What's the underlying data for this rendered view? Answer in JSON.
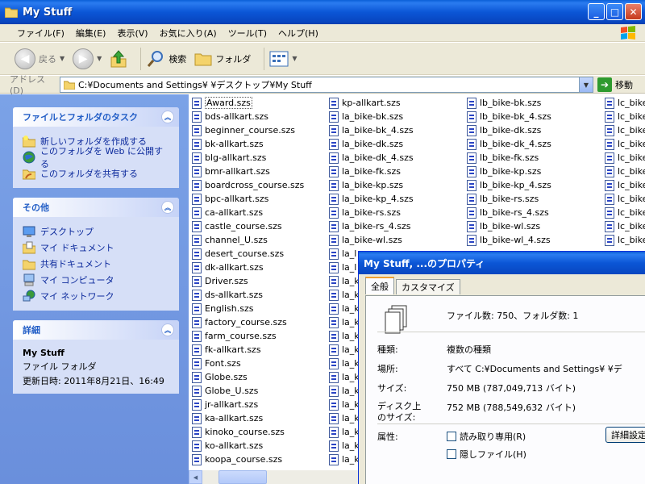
{
  "window": {
    "title": "My Stuff"
  },
  "menu": [
    "ファイル(F)",
    "編集(E)",
    "表示(V)",
    "お気に入り(A)",
    "ツール(T)",
    "ヘルプ(H)"
  ],
  "toolbar": {
    "back": "戻る",
    "search": "検索",
    "folders": "フォルダ"
  },
  "address": {
    "label": "アドレス(D)",
    "path": "C:¥Documents and Settings¥              ¥デスクトップ¥My Stuff",
    "go": "移動"
  },
  "tasks": {
    "title": "ファイルとフォルダのタスク",
    "items": [
      "新しいフォルダを作成する",
      "このフォルダを Web に公開する",
      "このフォルダを共有する"
    ]
  },
  "other": {
    "title": "その他",
    "items": [
      "デスクトップ",
      "マイ ドキュメント",
      "共有ドキュメント",
      "マイ コンピュータ",
      "マイ ネットワーク"
    ]
  },
  "details": {
    "title": "詳細",
    "name": "My Stuff",
    "type": "ファイル フォルダ",
    "modified": "更新日時: 2011年8月21日、16:49"
  },
  "files": {
    "col1": [
      "Award.szs",
      "bds-allkart.szs",
      "beginner_course.szs",
      "bk-allkart.szs",
      "blg-allkart.szs",
      "bmr-allkart.szs",
      "boardcross_course.szs",
      "bpc-allkart.szs",
      "ca-allkart.szs",
      "castle_course.szs",
      "channel_U.szs",
      "desert_course.szs",
      "dk-allkart.szs",
      "Driver.szs",
      "ds-allkart.szs",
      "English.szs",
      "factory_course.szs",
      "farm_course.szs",
      "fk-allkart.szs",
      "Font.szs",
      "Globe.szs",
      "Globe_U.szs",
      "jr-allkart.szs",
      "ka-allkart.szs",
      "kinoko_course.szs",
      "ko-allkart.szs",
      "koopa_course.szs"
    ],
    "col2": [
      "kp-allkart.szs",
      "la_bike-bk.szs",
      "la_bike-bk_4.szs",
      "la_bike-dk.szs",
      "la_bike-dk_4.szs",
      "la_bike-fk.szs",
      "la_bike-kp.szs",
      "la_bike-kp_4.szs",
      "la_bike-rs.szs",
      "la_bike-rs_4.szs",
      "la_bike-wl.szs",
      "la_l",
      "la_l",
      "la_k",
      "la_k",
      "la_k",
      "la_k",
      "la_k",
      "la_k",
      "la_k",
      "la_k",
      "la_k",
      "la_k",
      "la_k",
      "la_k",
      "la_k",
      "la_k"
    ],
    "col3": [
      "lb_bike-bk.szs",
      "lb_bike-bk_4.szs",
      "lb_bike-dk.szs",
      "lb_bike-dk_4.szs",
      "lb_bike-fk.szs",
      "lb_bike-kp.szs",
      "lb_bike-kp_4.szs",
      "lb_bike-rs.szs",
      "lb_bike-rs_4.szs",
      "lb_bike-wl.szs",
      "lb_bike-wl_4.szs"
    ],
    "col4": [
      "lc_bike",
      "lc_bike",
      "lc_bike",
      "lc_bike",
      "lc_bike",
      "lc_bike",
      "lc_bike",
      "lc_bike",
      "lc_bike",
      "lc_bike",
      "lc_bike"
    ]
  },
  "dialog": {
    "title": "My Stuff, ...のプロパティ",
    "tabs": [
      "全般",
      "カスタマイズ"
    ],
    "summary": "ファイル数: 750、フォルダ数: 1",
    "type_label": "種類:",
    "type_value": "複数の種類",
    "location_label": "場所:",
    "location_value": "すべて C:¥Documents and Settings¥              ¥デ",
    "size_label": "サイズ:",
    "size_value": "750 MB (787,049,713 バイト)",
    "disk_label_1": "ディスク上",
    "disk_label_2": "のサイズ:",
    "disk_value": "752 MB (788,549,632 バイト)",
    "attr_label": "属性:",
    "readonly": "読み取り専用(R)",
    "hidden": "隠しファイル(H)",
    "details_button": "詳細設定"
  }
}
